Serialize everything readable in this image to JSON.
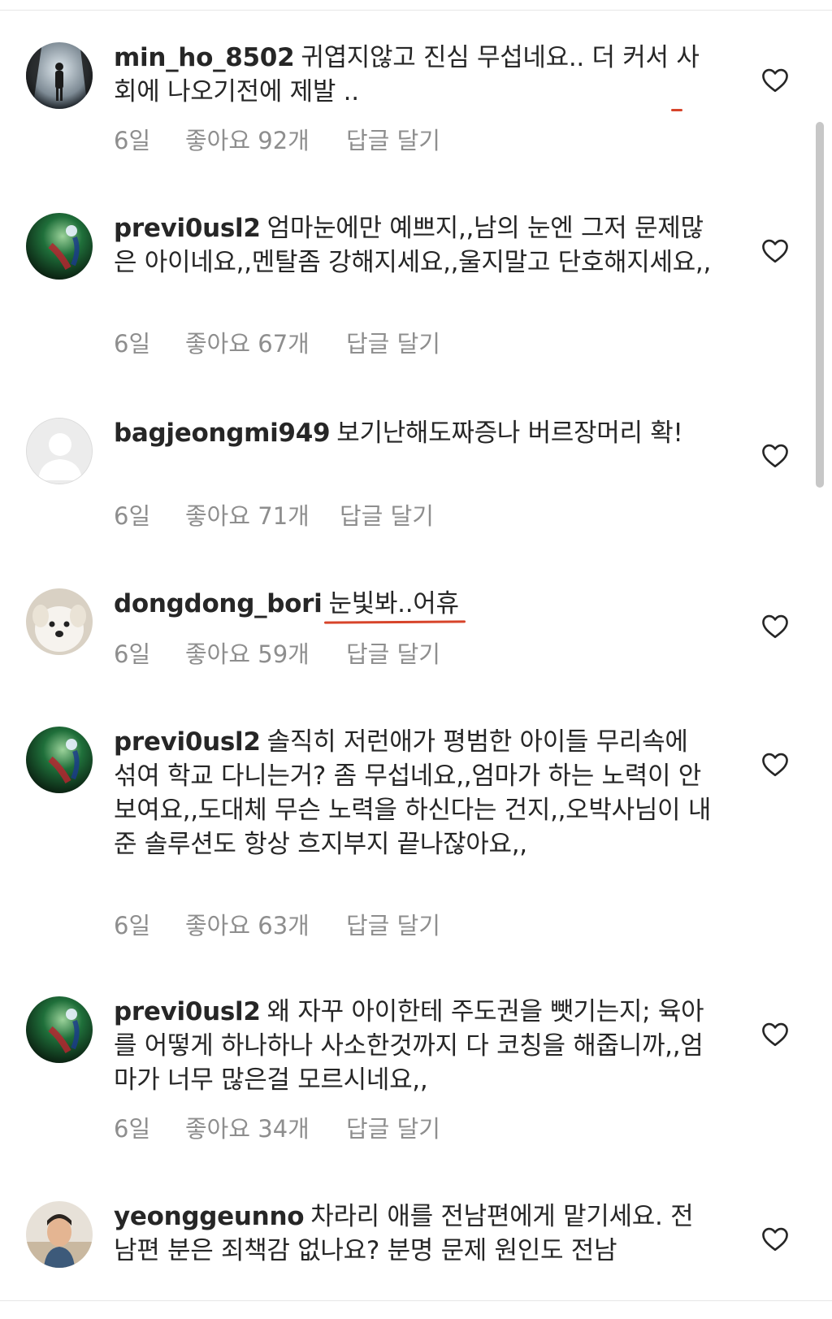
{
  "comments": [
    {
      "username": "min_ho_8502",
      "text_before": "귀엽지않고 진심 무섭네요.. 더 커서 ",
      "highlight": "사회에 나오기전에 제발 ..",
      "text_after": "",
      "age": "6일",
      "likes": "좋아요 92개",
      "reply": "답글 달기",
      "avatar": "silhouette-avatar"
    },
    {
      "username": "previ0usl2",
      "text_before": "엄마눈에만 예쁘지,,남의 눈엔 그저 문제많은 아이네요,,멘탈좀 강해지세요,,울지말고 단호해지세요,,",
      "highlight": "",
      "text_after": "",
      "age": "6일",
      "likes": "좋아요 67개",
      "reply": "답글 달기",
      "avatar": "green-orb-avatar"
    },
    {
      "username": "bagjeongmi949",
      "text_before": "보기난해도짜증나 버르장머리 확!",
      "highlight": "",
      "text_after": "",
      "age": "6일",
      "likes": "좋아요 71개",
      "reply": "답글 달기",
      "avatar": "default-avatar"
    },
    {
      "username": "dongdong_bori",
      "text_before": "",
      "highlight": "눈빛봐..어휴",
      "text_after": "",
      "age": "6일",
      "likes": "좋아요 59개",
      "reply": "답글 달기",
      "avatar": "puppy-avatar"
    },
    {
      "username": "previ0usl2",
      "text_before": "솔직히 저런애가 평범한 아이들 무리속에 섞여 학교 다니는거? 좀 무섭네요,,엄마가 하는 노력이 안보여요,,도대체 무슨 노력을 하신다는 건지,,오박사님이 내준 솔루션도 항상 흐지부지 끝나잖아요,,",
      "highlight": "",
      "text_after": "",
      "age": "6일",
      "likes": "좋아요 63개",
      "reply": "답글 달기",
      "avatar": "green-orb-avatar"
    },
    {
      "username": "previ0usl2",
      "text_before": "왜 자꾸 아이한테 주도권을 뺏기는지; 육아를 어떻게 하나하나 사소한것까지 다 코칭을 해줍니까,,엄마가 너무 많은걸 모르시네요,,",
      "highlight": "",
      "text_after": "",
      "age": "6일",
      "likes": "좋아요 34개",
      "reply": "답글 달기",
      "avatar": "green-orb-avatar"
    },
    {
      "username": "yeonggeunno",
      "text_before": "차라리 애를 전남편에게 맡기세요. 전남편 분은 죄책감 없나요? 분명 문제 원인도 전남",
      "highlight": "",
      "text_after": "",
      "age": "",
      "likes": "",
      "reply": "",
      "avatar": "person-photo-avatar"
    }
  ],
  "colors": {
    "text": "#262626",
    "meta": "#8e8e8e",
    "underline": "#d7442a"
  },
  "icons": {
    "like": "heart-outline-icon"
  }
}
